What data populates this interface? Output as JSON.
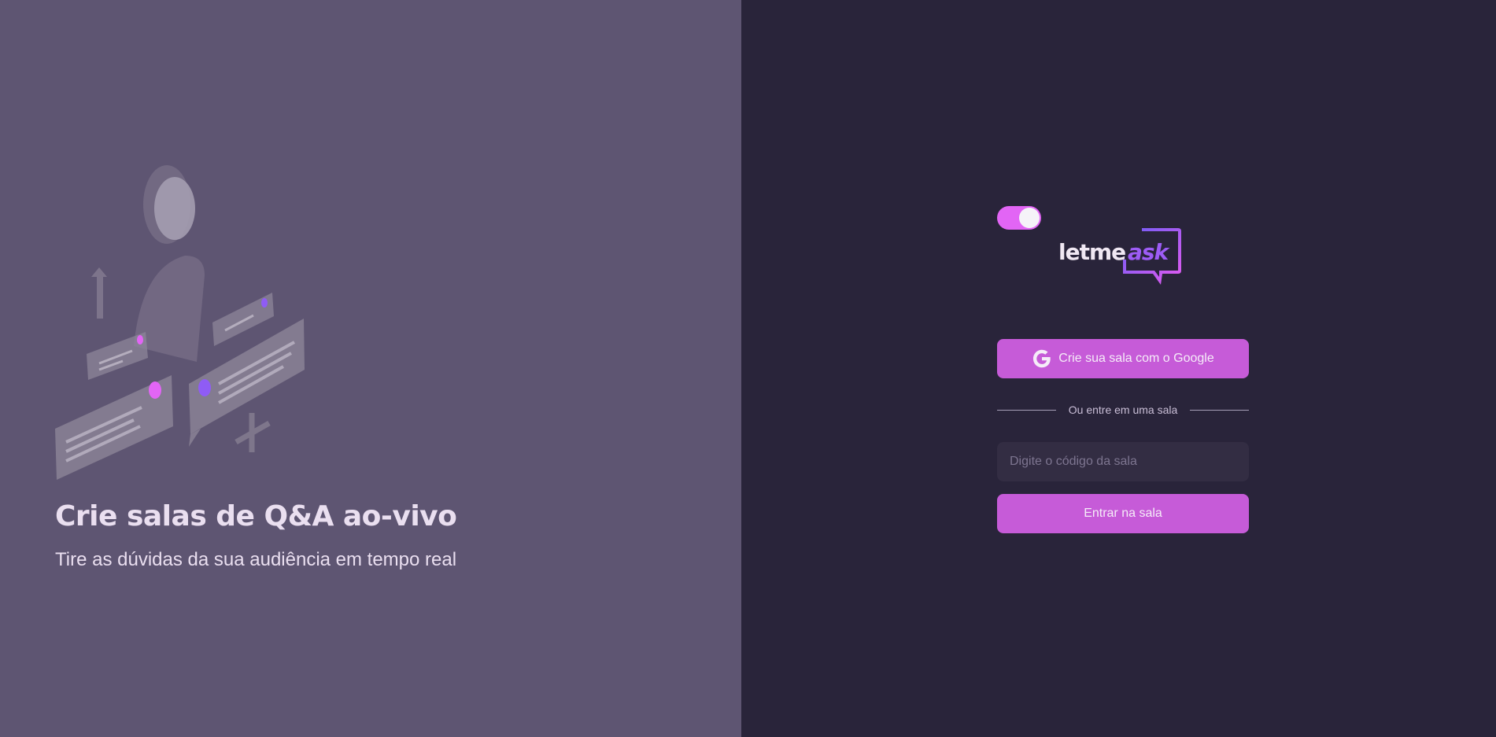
{
  "aside": {
    "title": "Crie salas de Q&A ao-vivo",
    "subtitle": "Tire as dúvidas da sua audiência em tempo real"
  },
  "main": {
    "theme_toggle": {
      "state": "on"
    },
    "logo": {
      "part1": "letme",
      "part2": "ask"
    },
    "google_button_label": "Crie sua sala com o Google",
    "separator_text": "Ou entre em uma sala",
    "room_input": {
      "placeholder": "Digite o código da sala",
      "value": ""
    },
    "enter_button_label": "Entrar na sala"
  },
  "colors": {
    "aside_bg": "#5e5572",
    "main_bg": "#29243a",
    "accent": "#c65bd8",
    "toggle": "#e265f5"
  }
}
